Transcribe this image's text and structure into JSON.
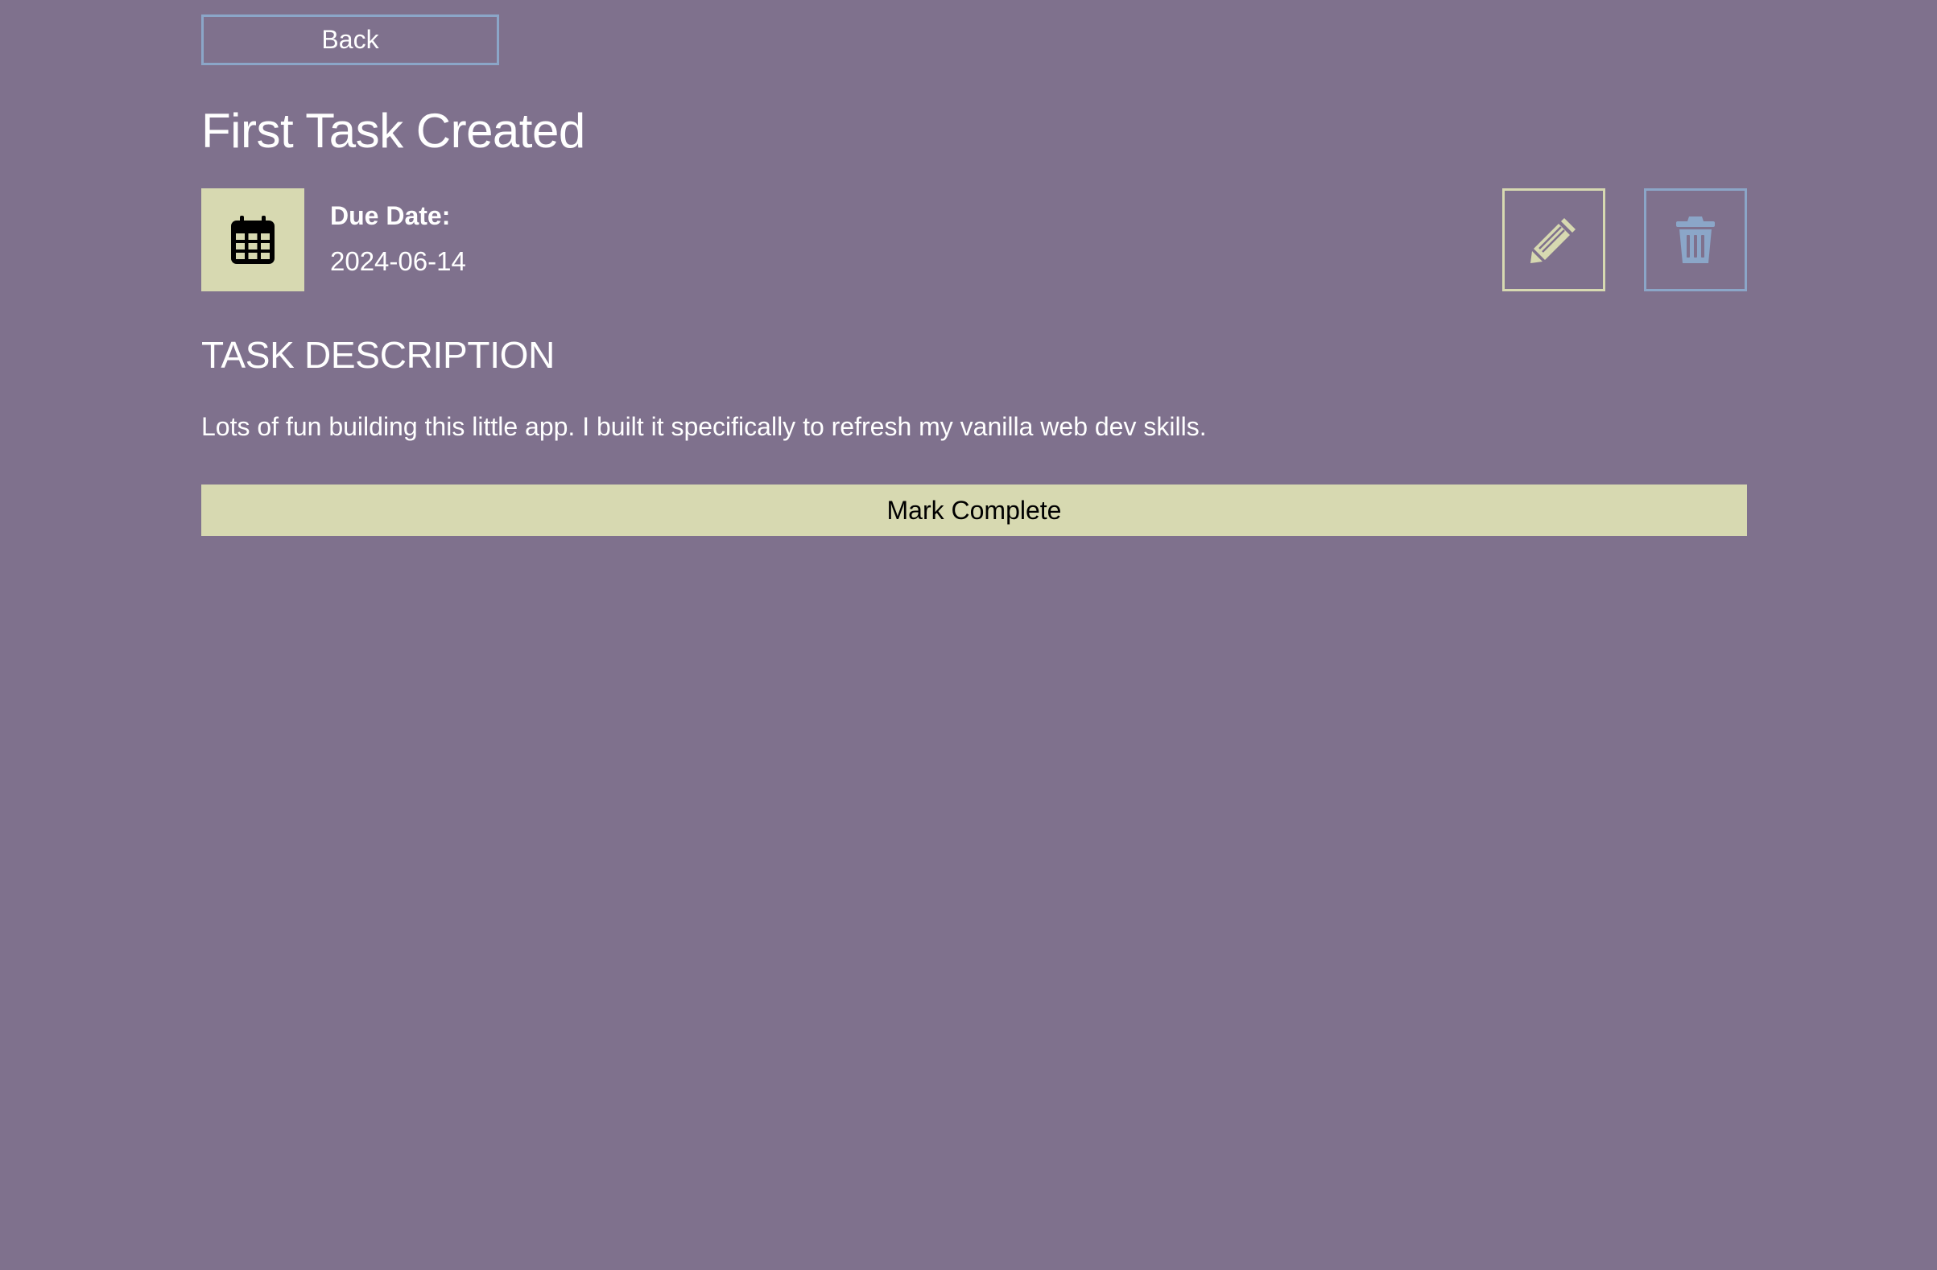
{
  "nav": {
    "back_label": "Back"
  },
  "task": {
    "title": "First Task Created",
    "due_label": "Due Date:",
    "due_value": "2024-06-14",
    "description_heading": "TASK DESCRIPTION",
    "description": "Lots of fun building this little app. I built it specifically to refresh my vanilla web dev skills."
  },
  "actions": {
    "edit_icon": "pencil-icon",
    "delete_icon": "trash-icon",
    "mark_complete_label": "Mark Complete"
  },
  "colors": {
    "background": "#7f718d",
    "accent_green": "#d7d9b1",
    "accent_blue": "#8ba6c8"
  }
}
